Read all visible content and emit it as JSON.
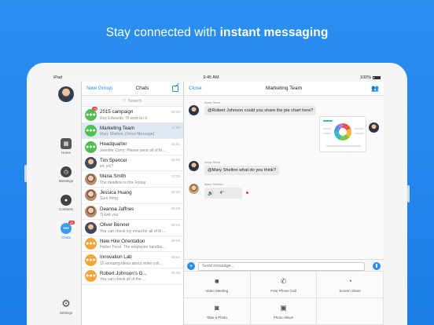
{
  "headline": {
    "prefix": "Stay connected with ",
    "bold": "instant messaging"
  },
  "statusbar": {
    "carrier": "iPad",
    "time": "9:45 AM",
    "battery": "100%"
  },
  "rail": {
    "items": [
      {
        "label": "Home",
        "icon": "home-icon"
      },
      {
        "label": "Meetings",
        "icon": "clock-icon"
      },
      {
        "label": "Contacts",
        "icon": "person-icon"
      },
      {
        "label": "Chats",
        "icon": "chat-icon",
        "badge": "25"
      },
      {
        "label": "Settings",
        "icon": "gear-icon"
      }
    ]
  },
  "chats": {
    "new_group": "New Group",
    "title": "Chats",
    "search_placeholder": "Search",
    "rows": [
      {
        "name": "2015 campaign",
        "msg": "Roy Edwards: I'll work on it",
        "time": "09:30",
        "avatar": "group-green",
        "badge": "25"
      },
      {
        "name": "Marketing Team",
        "msg": "Mary Shelton: [Voice Message]",
        "time": "17:50",
        "avatar": "group-green"
      },
      {
        "name": "Headquarter",
        "msg": "Jennifer Curry: Please send all of this m...",
        "time": "16:01",
        "avatar": "group-green"
      },
      {
        "name": "Tim Spencer",
        "msg": "lol, y/n?",
        "time": "15:50",
        "avatar": "photo"
      },
      {
        "name": "Maria Smith",
        "msg": "The deadline is this Friday",
        "time": "13:30",
        "avatar": "photo2"
      },
      {
        "name": "Jessica Huang",
        "msg": "Sure thing",
        "time": "10:20",
        "avatar": "photo2"
      },
      {
        "name": "Deanna Jaffries",
        "msg": "Thank you",
        "time": "09:25",
        "avatar": "photo2"
      },
      {
        "name": "Oliver Benner",
        "msg": "You can check my email for all of the ...",
        "time": "09:01",
        "avatar": "photo"
      },
      {
        "name": "New Hire Orientation",
        "msg": "Hellen Frost: The employee handbook ...",
        "time": "08:59",
        "avatar": "group-orange"
      },
      {
        "name": "Innovation Lab",
        "msg": "10 amazing ideas about video coll...",
        "time": "08:52",
        "avatar": "group-orange"
      },
      {
        "name": "Robert Johnson's G...",
        "msg": "You can check all of the ...",
        "time": "08:30",
        "avatar": "group-orange"
      }
    ]
  },
  "conversation": {
    "close": "Close",
    "title": "Marketing Team",
    "messages": [
      {
        "sender": "Anna Shea",
        "text": "@Robert Johnson could you share the pie chart here?"
      },
      {
        "sender": "Anna Shea",
        "text": "@Mary Shelton what do you think?"
      },
      {
        "sender": "Mary Shelton",
        "voice_duration": "4\""
      }
    ],
    "input_placeholder": "Send message...",
    "actions": [
      {
        "label": "Video Meeting",
        "icon": "video-camera-icon",
        "glyph": "■"
      },
      {
        "label": "Free Phone Call",
        "icon": "phone-icon",
        "glyph": "✆"
      },
      {
        "label": "Screen Share",
        "icon": "screen-share-icon",
        "glyph": "◔"
      },
      {
        "label": "Take a Photo",
        "icon": "camera-icon",
        "glyph": "◙"
      },
      {
        "label": "Photo Album",
        "icon": "photo-album-icon",
        "glyph": "▣"
      },
      {
        "label": "",
        "icon": "",
        "glyph": ""
      }
    ]
  }
}
